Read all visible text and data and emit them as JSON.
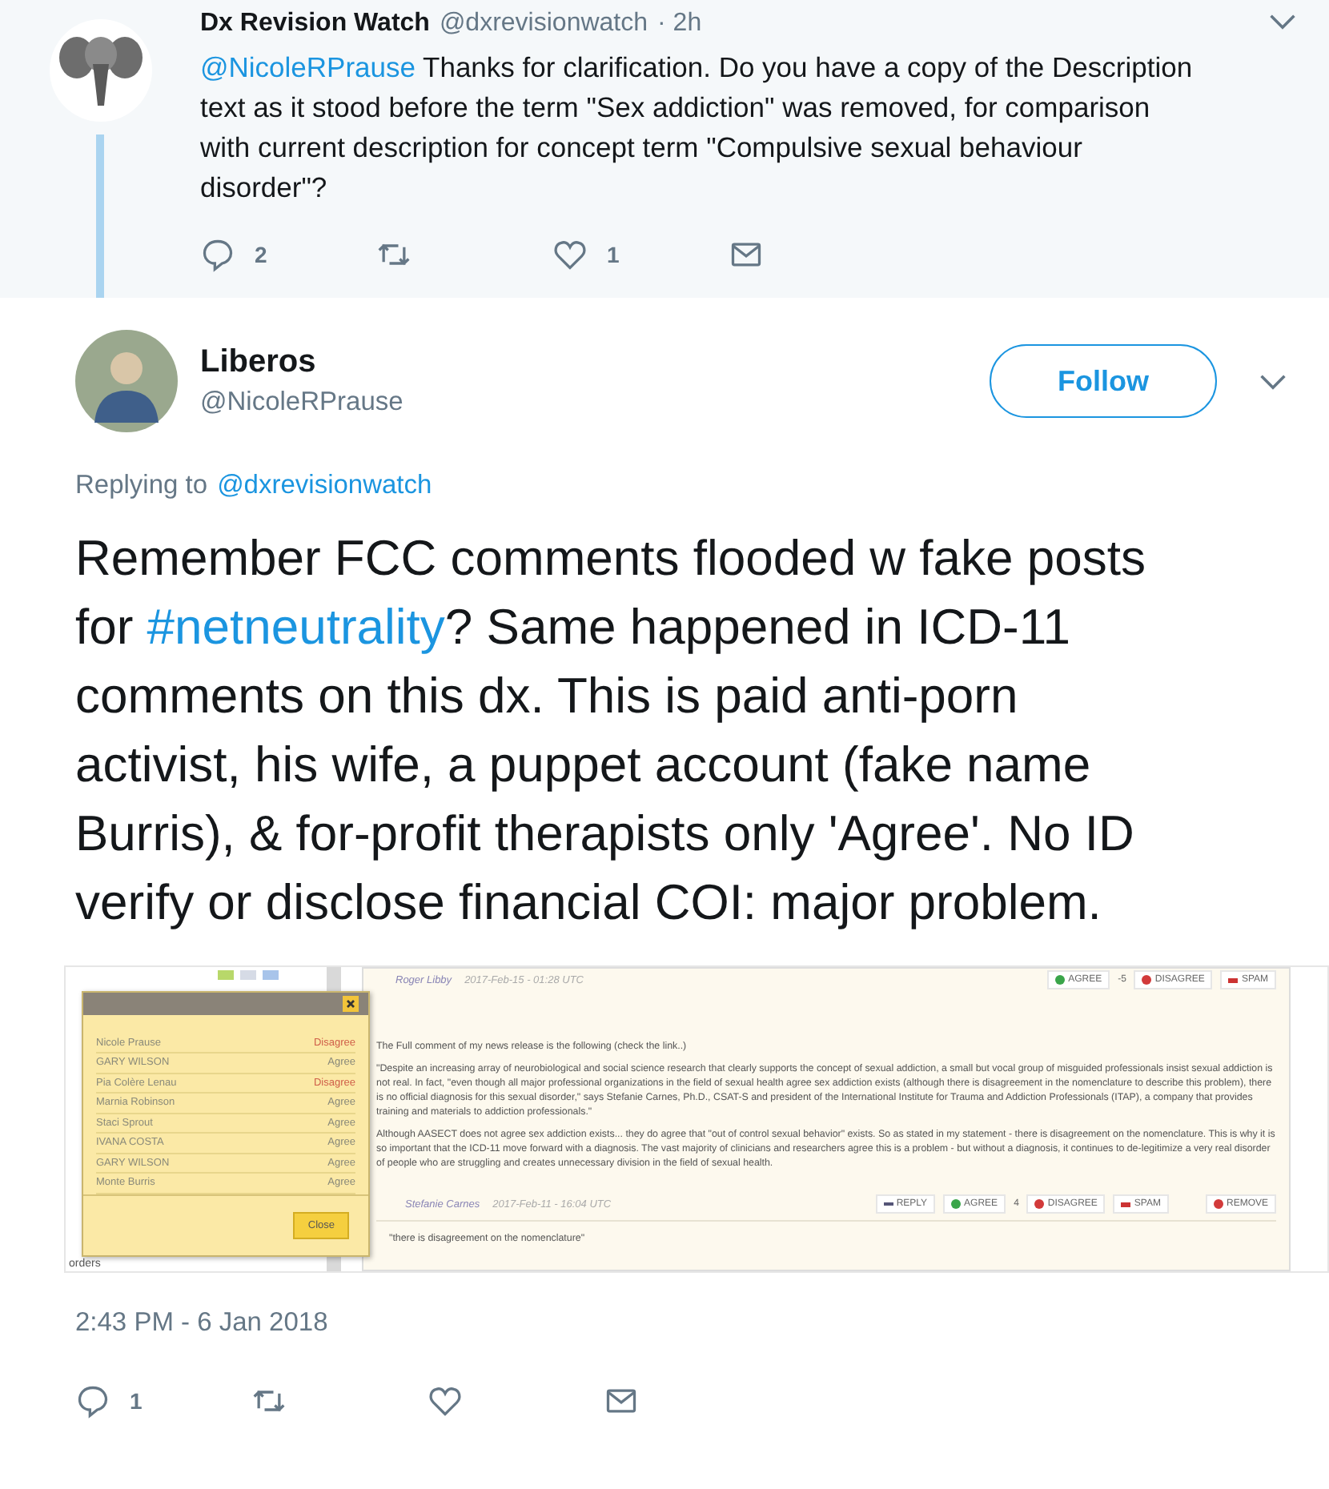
{
  "parent_tweet": {
    "name": "Dx Revision Watch",
    "handle": "@dxrevisionwatch",
    "time": "· 2h",
    "mention": "@NicoleRPrause",
    "text": "Thanks for clarification. Do you have a copy of the Description text as it stood before the term \"Sex addiction\" was removed, for comparison with current description for concept term \"Compulsive sexual behaviour disorder\"?",
    "replies": "2",
    "likes": "1"
  },
  "tweet": {
    "name": "Liberos",
    "handle": "@NicoleRPrause",
    "follow_button": "Follow",
    "replying_label": "Replying to",
    "replying_to": "@dxrevisionwatch",
    "body": [
      {
        "kind": "text",
        "text": "Remember FCC comments flooded w fake posts for "
      },
      {
        "kind": "hashtag",
        "text": "#netneutrality"
      },
      {
        "kind": "text",
        "text": "? Same happened in ICD-11 comments on this dx. This is paid anti-porn activist, his wife, a puppet account (fake name Burris), & for-profit therapists only 'Agree'. No ID verify or disclose financial COI: major problem."
      }
    ],
    "time": "2:43 PM - 6 Jan 2018",
    "replies": "1"
  },
  "attachment": {
    "side_text": "orders",
    "top_comment": {
      "author": "Roger Libby",
      "date": "2017-Feb-15 - 01:28 UTC",
      "buttons": [
        {
          "kind": "agree",
          "label": "AGREE"
        },
        {
          "kind": "count",
          "label": "-5"
        },
        {
          "kind": "disagree",
          "label": "DISAGREE"
        },
        {
          "kind": "spam",
          "label": "SPAM"
        }
      ]
    },
    "popup": {
      "votes": [
        {
          "name": "Nicole Prause",
          "vote": "Disagree",
          "kind": "disagree"
        },
        {
          "name": "GARY WILSON",
          "vote": "Agree",
          "kind": "agree"
        },
        {
          "name": "Pia Colère Lenau",
          "vote": "Disagree",
          "kind": "disagree"
        },
        {
          "name": "Marnia Robinson",
          "vote": "Agree",
          "kind": "agree"
        },
        {
          "name": "Staci Sprout",
          "vote": "Agree",
          "kind": "agree"
        },
        {
          "name": "IVANA COSTA",
          "vote": "Agree",
          "kind": "agree"
        },
        {
          "name": "GARY WILSON",
          "vote": "Agree",
          "kind": "agree"
        },
        {
          "name": "Monte Burris",
          "vote": "Agree",
          "kind": "agree"
        }
      ],
      "close_button": "Close"
    },
    "comment": {
      "paragraphs": [
        "The Full comment of my news release is the following (check the link..)",
        "\"Despite an increasing array of neurobiological and social science research that clearly supports the concept of sexual addiction, a small but vocal group of misguided professionals insist sexual addiction is not real. In fact, \"even though all major professional organizations in the field of sexual health agree sex addiction exists (although there is disagreement in the nomenclature to describe this problem), there is no official diagnosis for this sexual disorder,\" says Stefanie Carnes, Ph.D., CSAT-S and president of the International Institute for Trauma and Addiction Professionals (ITAP), a company that provides training and materials to addiction professionals.\"",
        "Although AASECT does not agree sex addiction exists... they do agree that \"out of control sexual behavior\" exists. So as stated in my statement - there is disagreement on the nomenclature. This is why it is so important that the ICD-11 move forward with a diagnosis. The vast majority of clinicians and researchers agree this is a problem - but without a diagnosis, it continues to de-legitimize a very real disorder of people who are struggling and creates unnecessary division in the field of sexual health."
      ],
      "author": "Stefanie Carnes",
      "date": "2017-Feb-11 - 16:04 UTC",
      "buttons": [
        {
          "kind": "reply",
          "label": "REPLY"
        },
        {
          "kind": "agree",
          "label": "AGREE"
        },
        {
          "kind": "count",
          "label": "4"
        },
        {
          "kind": "disagree",
          "label": "DISAGREE"
        },
        {
          "kind": "spam",
          "label": "SPAM"
        },
        {
          "kind": "remove",
          "label": "REMOVE"
        }
      ]
    },
    "reply_quote": "\"there is disagreement on the nomenclature\""
  }
}
